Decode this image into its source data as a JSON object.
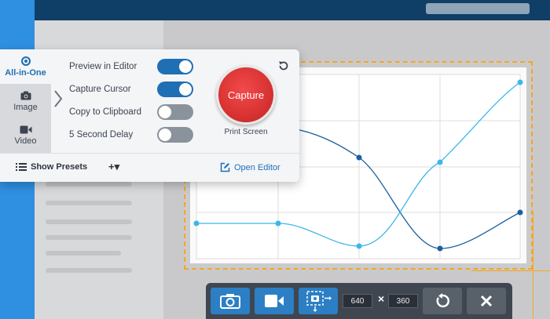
{
  "capture_panel": {
    "modes": [
      {
        "label": "All-in-One",
        "icon": "radio-icon",
        "active": true
      },
      {
        "label": "Image",
        "icon": "camera-icon",
        "active": false
      },
      {
        "label": "Video",
        "icon": "video-icon",
        "active": false
      }
    ],
    "options": [
      {
        "label": "Preview in Editor",
        "enabled": true
      },
      {
        "label": "Capture Cursor",
        "enabled": true
      },
      {
        "label": "Copy to Clipboard",
        "enabled": false
      },
      {
        "label": "5 Second Delay",
        "enabled": false
      }
    ],
    "capture_label": "Capture",
    "shortcut_label": "Print Screen",
    "show_presets_label": "Show Presets",
    "add_preset_label": "+▾",
    "open_editor_label": "Open Editor"
  },
  "toolbar": {
    "width_value": "640",
    "height_value": "360",
    "separator": "×"
  },
  "colors": {
    "accent": "#1f6fb5",
    "capture_red": "#d83232",
    "region_border": "#f5a623",
    "chart_dark_series": "#1a5fa0",
    "chart_light_series": "#3bb7ea"
  }
}
